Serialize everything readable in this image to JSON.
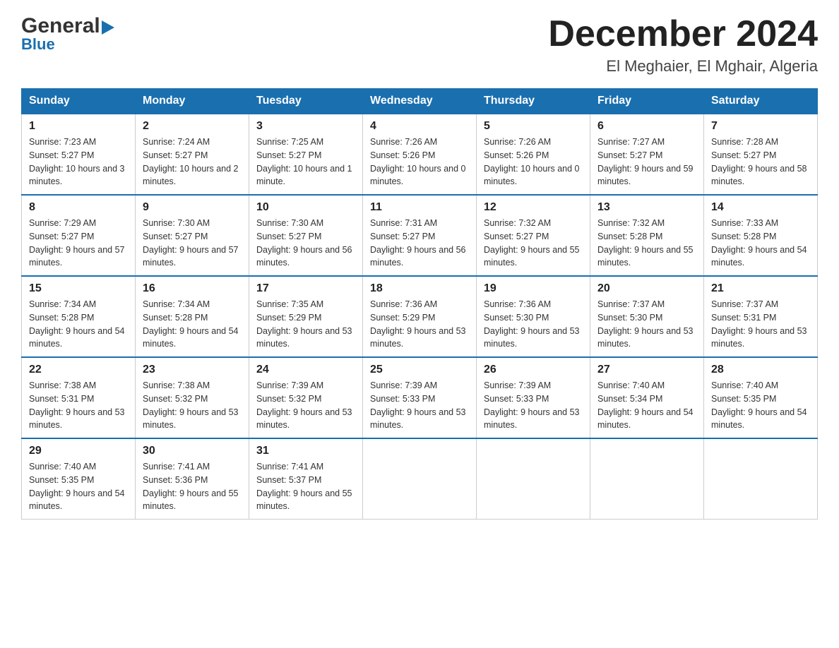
{
  "header": {
    "logo_general": "General",
    "logo_blue": "Blue",
    "month_title": "December 2024",
    "location": "El Meghaier, El Mghair, Algeria"
  },
  "weekdays": [
    "Sunday",
    "Monday",
    "Tuesday",
    "Wednesday",
    "Thursday",
    "Friday",
    "Saturday"
  ],
  "weeks": [
    [
      {
        "day": "1",
        "sunrise": "7:23 AM",
        "sunset": "5:27 PM",
        "daylight": "10 hours and 3 minutes."
      },
      {
        "day": "2",
        "sunrise": "7:24 AM",
        "sunset": "5:27 PM",
        "daylight": "10 hours and 2 minutes."
      },
      {
        "day": "3",
        "sunrise": "7:25 AM",
        "sunset": "5:27 PM",
        "daylight": "10 hours and 1 minute."
      },
      {
        "day": "4",
        "sunrise": "7:26 AM",
        "sunset": "5:26 PM",
        "daylight": "10 hours and 0 minutes."
      },
      {
        "day": "5",
        "sunrise": "7:26 AM",
        "sunset": "5:26 PM",
        "daylight": "10 hours and 0 minutes."
      },
      {
        "day": "6",
        "sunrise": "7:27 AM",
        "sunset": "5:27 PM",
        "daylight": "9 hours and 59 minutes."
      },
      {
        "day": "7",
        "sunrise": "7:28 AM",
        "sunset": "5:27 PM",
        "daylight": "9 hours and 58 minutes."
      }
    ],
    [
      {
        "day": "8",
        "sunrise": "7:29 AM",
        "sunset": "5:27 PM",
        "daylight": "9 hours and 57 minutes."
      },
      {
        "day": "9",
        "sunrise": "7:30 AM",
        "sunset": "5:27 PM",
        "daylight": "9 hours and 57 minutes."
      },
      {
        "day": "10",
        "sunrise": "7:30 AM",
        "sunset": "5:27 PM",
        "daylight": "9 hours and 56 minutes."
      },
      {
        "day": "11",
        "sunrise": "7:31 AM",
        "sunset": "5:27 PM",
        "daylight": "9 hours and 56 minutes."
      },
      {
        "day": "12",
        "sunrise": "7:32 AM",
        "sunset": "5:27 PM",
        "daylight": "9 hours and 55 minutes."
      },
      {
        "day": "13",
        "sunrise": "7:32 AM",
        "sunset": "5:28 PM",
        "daylight": "9 hours and 55 minutes."
      },
      {
        "day": "14",
        "sunrise": "7:33 AM",
        "sunset": "5:28 PM",
        "daylight": "9 hours and 54 minutes."
      }
    ],
    [
      {
        "day": "15",
        "sunrise": "7:34 AM",
        "sunset": "5:28 PM",
        "daylight": "9 hours and 54 minutes."
      },
      {
        "day": "16",
        "sunrise": "7:34 AM",
        "sunset": "5:28 PM",
        "daylight": "9 hours and 54 minutes."
      },
      {
        "day": "17",
        "sunrise": "7:35 AM",
        "sunset": "5:29 PM",
        "daylight": "9 hours and 53 minutes."
      },
      {
        "day": "18",
        "sunrise": "7:36 AM",
        "sunset": "5:29 PM",
        "daylight": "9 hours and 53 minutes."
      },
      {
        "day": "19",
        "sunrise": "7:36 AM",
        "sunset": "5:30 PM",
        "daylight": "9 hours and 53 minutes."
      },
      {
        "day": "20",
        "sunrise": "7:37 AM",
        "sunset": "5:30 PM",
        "daylight": "9 hours and 53 minutes."
      },
      {
        "day": "21",
        "sunrise": "7:37 AM",
        "sunset": "5:31 PM",
        "daylight": "9 hours and 53 minutes."
      }
    ],
    [
      {
        "day": "22",
        "sunrise": "7:38 AM",
        "sunset": "5:31 PM",
        "daylight": "9 hours and 53 minutes."
      },
      {
        "day": "23",
        "sunrise": "7:38 AM",
        "sunset": "5:32 PM",
        "daylight": "9 hours and 53 minutes."
      },
      {
        "day": "24",
        "sunrise": "7:39 AM",
        "sunset": "5:32 PM",
        "daylight": "9 hours and 53 minutes."
      },
      {
        "day": "25",
        "sunrise": "7:39 AM",
        "sunset": "5:33 PM",
        "daylight": "9 hours and 53 minutes."
      },
      {
        "day": "26",
        "sunrise": "7:39 AM",
        "sunset": "5:33 PM",
        "daylight": "9 hours and 53 minutes."
      },
      {
        "day": "27",
        "sunrise": "7:40 AM",
        "sunset": "5:34 PM",
        "daylight": "9 hours and 54 minutes."
      },
      {
        "day": "28",
        "sunrise": "7:40 AM",
        "sunset": "5:35 PM",
        "daylight": "9 hours and 54 minutes."
      }
    ],
    [
      {
        "day": "29",
        "sunrise": "7:40 AM",
        "sunset": "5:35 PM",
        "daylight": "9 hours and 54 minutes."
      },
      {
        "day": "30",
        "sunrise": "7:41 AM",
        "sunset": "5:36 PM",
        "daylight": "9 hours and 55 minutes."
      },
      {
        "day": "31",
        "sunrise": "7:41 AM",
        "sunset": "5:37 PM",
        "daylight": "9 hours and 55 minutes."
      },
      null,
      null,
      null,
      null
    ]
  ],
  "labels": {
    "sunrise": "Sunrise:",
    "sunset": "Sunset:",
    "daylight": "Daylight:"
  }
}
